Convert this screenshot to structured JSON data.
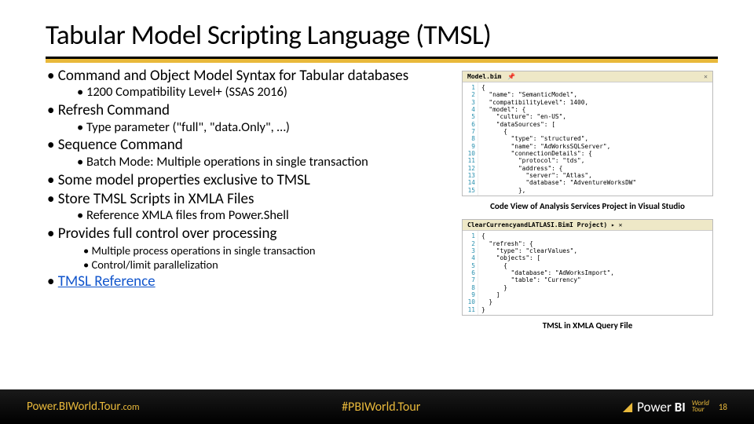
{
  "title": "Tabular Model Scripting Language (TMSL)",
  "bullets": {
    "b1": "Command and Object Model Syntax for Tabular databases",
    "b1a": "1200 Compatibility Level+ (SSAS 2016)",
    "b2": "Refresh Command",
    "b2a": "Type parameter (\"full\", \"data.Only\", …)",
    "b3": "Sequence Command",
    "b3a": "Batch Mode:  Multiple operations in single transaction",
    "b4": "Some model properties exclusive to TMSL",
    "b5": "Store TMSL Scripts in XMLA Files",
    "b5a": "Reference XMLA files from Power.Shell",
    "b6": "Provides full control over processing",
    "b6a": "Multiple process operations in single transaction",
    "b6b": "Control/limit parallelization",
    "b7": "TMSL Reference"
  },
  "code1": {
    "tab": "Model.bim",
    "lines": "{\n  \"name\": \"SemanticModel\",\n  \"compatibilityLevel\": 1400,\n  \"model\": {\n    \"culture\": \"en-US\",\n    \"dataSources\": [\n      {\n        \"type\": \"structured\",\n        \"name\": \"AdWorksSQLServer\",\n        \"connectionDetails\": {\n          \"protocol\": \"tds\",\n          \"address\": {\n            \"server\": \"Atlas\",\n            \"database\": \"AdventureWorksDW\"\n          },",
    "caption": "Code View of Analysis Services Project in Visual Studio"
  },
  "code2": {
    "tab": "ClearCurrencyandLATLASI.BimI Project) ▸ ✕",
    "lines": "{\n  \"refresh\": {\n    \"type\": \"clearValues\",\n    \"objects\": [\n      {\n        \"database\": \"AdWorksImport\",\n        \"table\": \"Currency\"\n      }\n    ]\n  }\n}",
    "caption": "TMSL in XMLA Query File"
  },
  "footer": {
    "url1": "Power.BIWorld.Tour",
    "url2": ".com",
    "hash": "#PBIWorld.Tour",
    "brand": "Power BI",
    "wt": "World\nTour",
    "page": "18"
  }
}
